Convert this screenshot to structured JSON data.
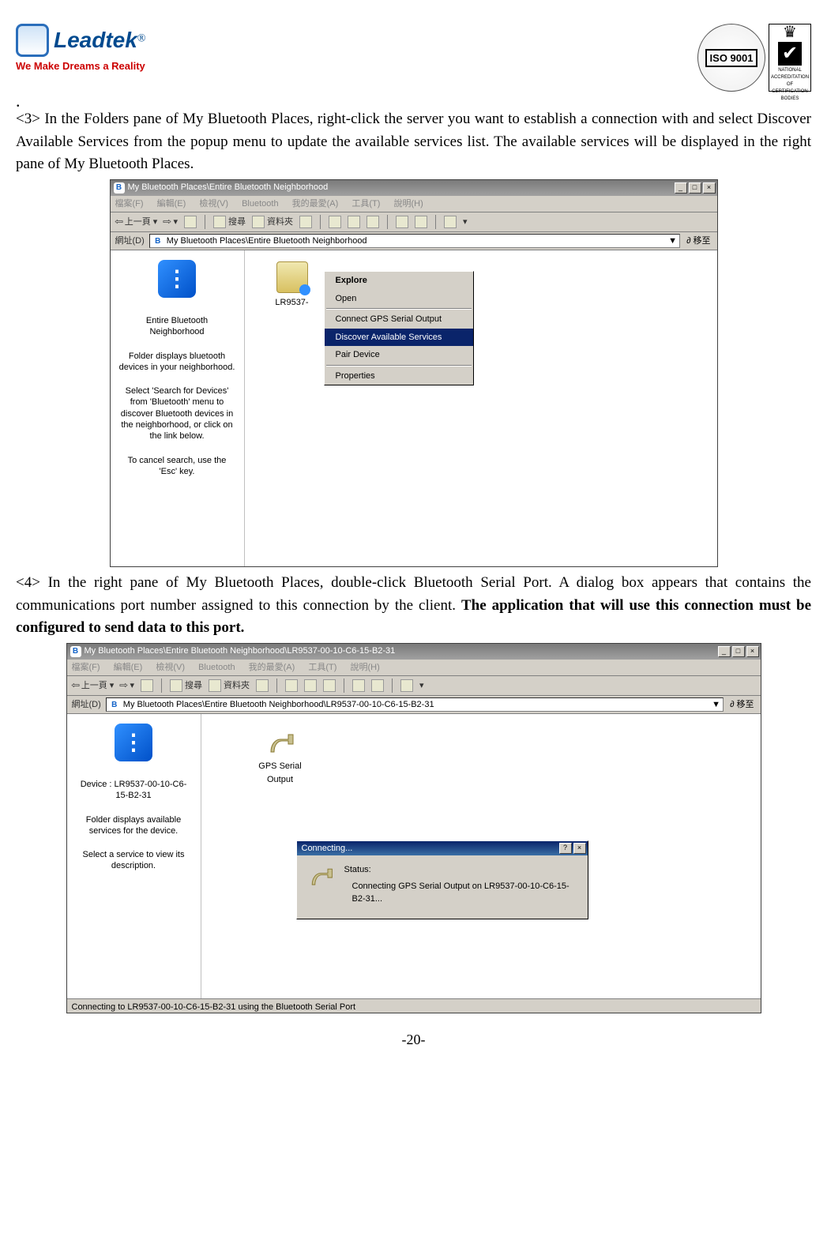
{
  "header": {
    "brand": "Leadtek",
    "registered": "®",
    "tagline": "We Make Dreams a Reality",
    "iso_label": "ISO\n9001",
    "accred_label": "NATIONAL ACCREDITATION OF CERTIFICATION BODIES"
  },
  "para3": "<3> In the Folders pane of My Bluetooth Places, right-click the server you want to establish a connection with and select Discover Available Services from the popup menu to update the available services list. The available services will be displayed in the right pane of My Bluetooth Places.",
  "para4_a": "<4> In the right pane of My Bluetooth Places, double-click Bluetooth Serial Port. A dialog box appears that contains the communications port number assigned to this connection by the client. ",
  "para4_b": "The application that will use this connection must be configured to send data to this port.",
  "page_number": "-20-",
  "win1": {
    "title": "My Bluetooth Places\\Entire Bluetooth Neighborhood",
    "menus": [
      "檔案(F)",
      "編輯(E)",
      "檢視(V)",
      "Bluetooth",
      "我的最愛(A)",
      "工具(T)",
      "說明(H)"
    ],
    "nav_back": "上一頁",
    "tb_search": "搜尋",
    "tb_folders": "資料夾",
    "addr_label": "網址(D)",
    "addr_value": "My Bluetooth Places\\Entire Bluetooth Neighborhood",
    "go_label": "移至",
    "side_title": "Entire Bluetooth Neighborhood",
    "side_p1": "Folder displays bluetooth devices in your neighborhood.",
    "side_p2": "Select 'Search for Devices' from 'Bluetooth' menu to discover Bluetooth devices in the neighborhood, or click on the link below.",
    "side_p3": "To cancel search, use the 'Esc' key.",
    "device_label": "LR9537-",
    "ctx": {
      "explore": "Explore",
      "open": "Open",
      "connect": "Connect GPS Serial Output",
      "discover": "Discover Available Services",
      "pair": "Pair Device",
      "properties": "Properties"
    }
  },
  "win2": {
    "title": "My Bluetooth Places\\Entire Bluetooth Neighborhood\\LR9537-00-10-C6-15-B2-31",
    "menus": [
      "檔案(F)",
      "編輯(E)",
      "檢視(V)",
      "Bluetooth",
      "我的最愛(A)",
      "工具(T)",
      "說明(H)"
    ],
    "nav_back": "上一頁",
    "tb_search": "搜尋",
    "tb_folders": "資料夾",
    "addr_label": "網址(D)",
    "addr_value": "My Bluetooth Places\\Entire Bluetooth Neighborhood\\LR9537-00-10-C6-15-B2-31",
    "go_label": "移至",
    "side_title": "Device : LR9537-00-10-C6-15-B2-31",
    "side_p1": "Folder displays available services for the device.",
    "side_p2": "Select a service to view its description.",
    "svc_label": "GPS Serial Output",
    "dlg_title": "Connecting...",
    "dlg_status_lbl": "Status:",
    "dlg_status_txt": "Connecting GPS Serial Output on LR9537-00-10-C6-15-B2-31...",
    "statusbar": "Connecting to LR9537-00-10-C6-15-B2-31 using the Bluetooth Serial Port"
  }
}
